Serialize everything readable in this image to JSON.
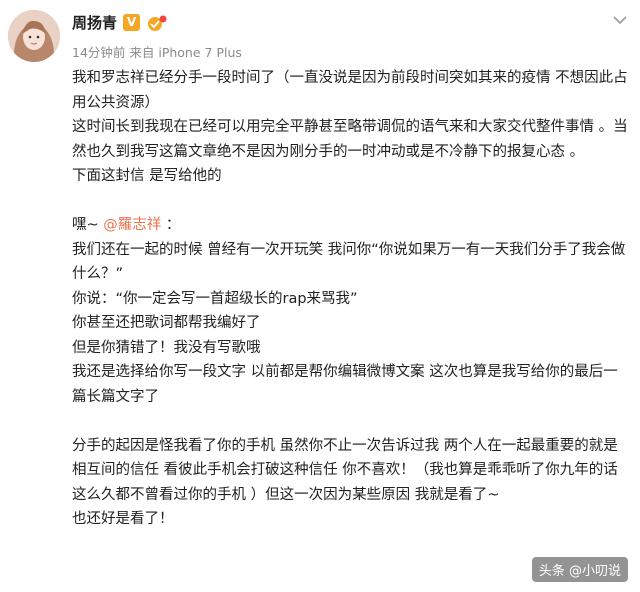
{
  "post": {
    "username": "周扬青",
    "verified_badge": "V",
    "meta": "14分钟前 来自 iPhone 7 Plus",
    "colors": {
      "accent": "#eb7350",
      "badge": "#f5a623",
      "meta": "#8a8a8a"
    },
    "icons": [
      "avatar",
      "verified-badge-icon",
      "member-icon",
      "chevron-down-icon"
    ]
  },
  "body": {
    "p1": "我和罗志祥已经分手一段时间了（一直没说是因为前段时间突如其来的疫情 不想因此占用公共资源）",
    "p2": "这时间长到我现在已经可以用完全平静甚至略带调侃的语气来和大家交代整件事情 。当然也久到我写这篇文章绝不是因为刚分手的一时冲动或是不冷静下的报复心态 。",
    "p3": "下面这封信 是写给他的",
    "greeting_prefix": "嘿~ ",
    "mention": "@羅志祥",
    "greeting_suffix": " ：",
    "p4": "我们还在一起的时候 曾经有一次开玩笑 我问你“你说如果万一有一天我们分手了我会做什么？”",
    "p5": "你说：“你一定会写一首超级长的rap来骂我”",
    "p6": "你甚至还把歌词都帮我编好了",
    "p7": "但是你猜错了！我没有写歌哦",
    "p8": "我还是选择给你写一段文字 以前都是帮你编辑微博文案 这次也算是我写给你的最后一篇长篇文字了",
    "p9": "分手的起因是怪我看了你的手机 虽然你不止一次告诉过我 两个人在一起最重要的就是相互间的信任 看彼此手机会打破这种信任 你不喜欢！（我也算是乖乖听了你九年的话 这么久都不曾看过你的手机 ）但这一次因为某些原因 我就是看了~",
    "p10": "也还好是看了！"
  },
  "watermark": {
    "text": "头条 @小叨说"
  }
}
